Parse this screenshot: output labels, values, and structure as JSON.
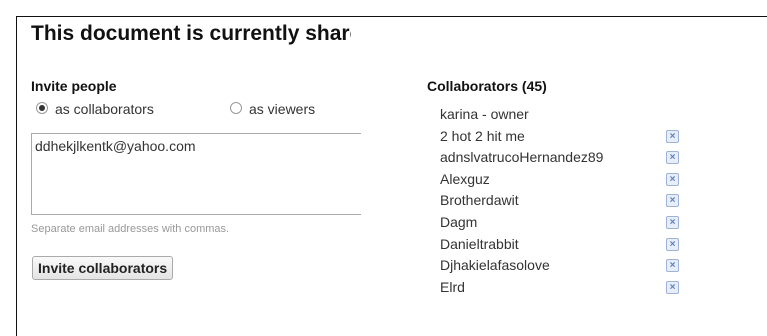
{
  "dialog": {
    "title": "This document is currently shared"
  },
  "invite": {
    "label": "Invite people",
    "option_collaborators": "as collaborators",
    "option_viewers": "as viewers",
    "selected": "collaborators",
    "emails_value": "ddhekjlkentk@yahoo.com",
    "hint": "Separate email addresses with commas.",
    "button_label": "Invite collaborators"
  },
  "collaborators": {
    "header": "Collaborators (45)",
    "owner": "karina - owner",
    "remove_glyph": "×",
    "items": [
      {
        "name": "2 hot 2 hit me"
      },
      {
        "name": "adnslvatrucoHernandez89"
      },
      {
        "name": "Alexguz"
      },
      {
        "name": "Brotherdawit"
      },
      {
        "name": "Dagm"
      },
      {
        "name": "Danieltrabbit"
      },
      {
        "name": "Djhakielafasolove"
      },
      {
        "name": "Elrd"
      }
    ]
  }
}
